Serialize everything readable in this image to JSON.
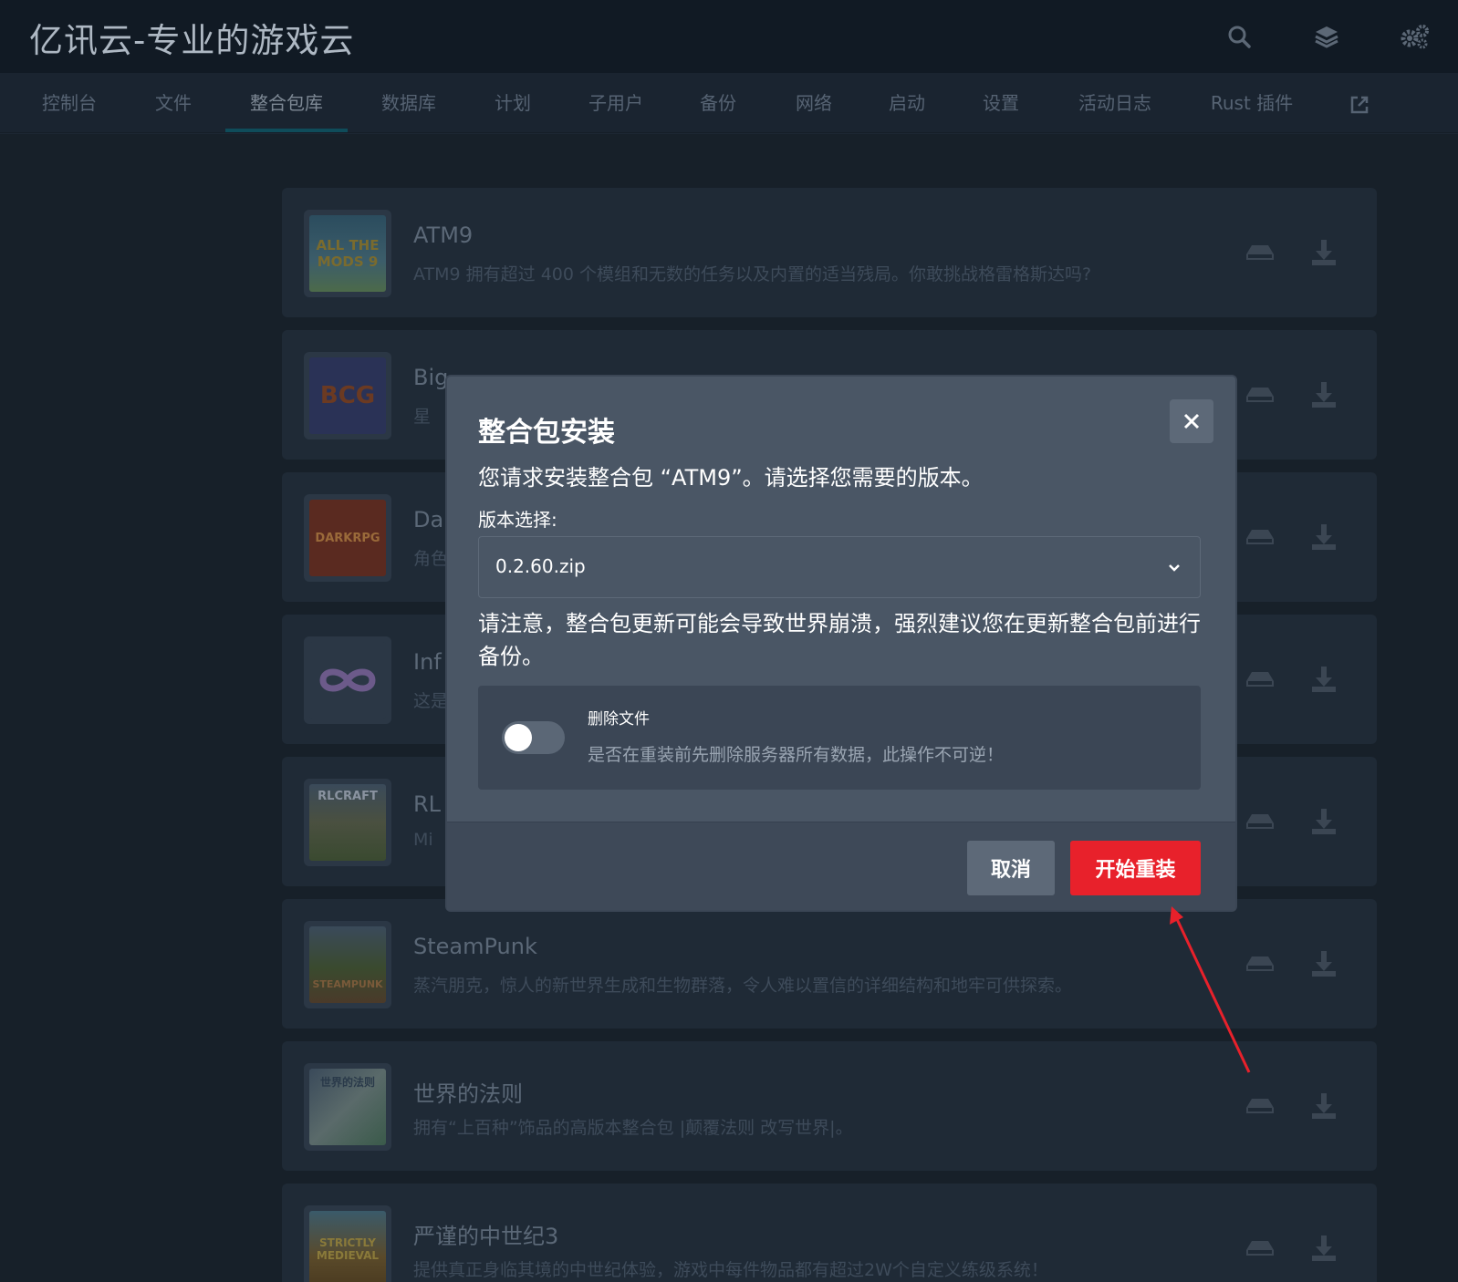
{
  "header": {
    "brand": "亿讯云-专业的游戏云",
    "icons": [
      "search-icon",
      "layers-icon",
      "gears-icon"
    ]
  },
  "nav": {
    "tabs": [
      {
        "label": "控制台"
      },
      {
        "label": "文件"
      },
      {
        "label": "整合包库",
        "active": true
      },
      {
        "label": "数据库"
      },
      {
        "label": "计划"
      },
      {
        "label": "子用户"
      },
      {
        "label": "备份"
      },
      {
        "label": "网络"
      },
      {
        "label": "启动"
      },
      {
        "label": "设置"
      },
      {
        "label": "活动日志"
      },
      {
        "label": "Rust 插件"
      }
    ],
    "external_icon": "external-link-icon"
  },
  "modpacks": [
    {
      "title": "ATM9",
      "desc": "ATM9 拥有超过 400 个模组和无数的任务以及内置的适当残局。你敢挑战格雷格斯达吗?",
      "thumb_text": "ALL THE MODS 9"
    },
    {
      "title": "Big",
      "desc": "星",
      "thumb_text": "BCG"
    },
    {
      "title": "Da",
      "desc": "角色",
      "thumb_text": "DARKRPG"
    },
    {
      "title": "Inf",
      "desc": "这是",
      "thumb_text": ""
    },
    {
      "title": "RL",
      "desc": "Mi",
      "thumb_text": "RLCRAFT"
    },
    {
      "title": "SteamPunk",
      "desc": "蒸汽朋克，惊人的新世界生成和生物群落，令人难以置信的详细结构和地牢可供探索。",
      "thumb_text": "STEAMPUNK"
    },
    {
      "title": "世界的法则",
      "desc": "拥有“上百种”饰品的高版本整合包 |颠覆法则 改写世界|。",
      "thumb_text": "世界的法则"
    },
    {
      "title": "严谨的中世纪3",
      "desc": "提供真正身临其境的中世纪体验，游戏中每件物品都有超过2W个自定义练级系统！",
      "thumb_text": "STRICTLY MEDIEVAL"
    }
  ],
  "modal": {
    "title": "整合包安装",
    "description": "您请求安装整合包 “ATM9”。请选择您需要的版本。",
    "version_label": "版本选择:",
    "version_value": "0.2.60.zip",
    "warning": "请注意，整合包更新可能会导致世界崩溃，强烈建议您在更新整合包前进行备份。",
    "delete_files_label": "删除文件",
    "delete_files_desc": "是否在重装前先删除服务器所有数据，此操作不可逆！",
    "delete_files_enabled": false,
    "cancel_label": "取消",
    "confirm_label": "开始重装"
  },
  "colors": {
    "confirm": "#e8212b",
    "annotation_arrow": "#e8212b"
  }
}
